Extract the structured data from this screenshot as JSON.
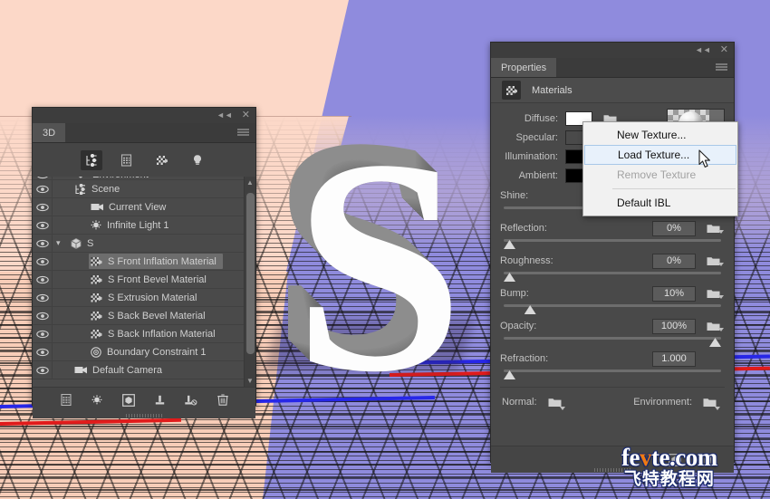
{
  "canvas": {
    "letter": "S",
    "background_color": "#fcd8c8",
    "plane_color": "#8f8bdd",
    "grid_color": "#141414",
    "axis_blue": "#2727e8",
    "axis_red": "#e01b1b"
  },
  "panel3d": {
    "tab_label": "3D",
    "collapse_icon": "double-chevron-left-icon",
    "close_icon": "close-icon",
    "menu_icon": "hamburger-menu-icon",
    "filters": [
      {
        "name": "scene-filter",
        "icon": "scene-tree-icon",
        "active": true
      },
      {
        "name": "mesh-filter",
        "icon": "mesh-grid-icon",
        "active": false
      },
      {
        "name": "materials-filter",
        "icon": "materials-icon",
        "active": false
      },
      {
        "name": "lights-filter",
        "icon": "light-bulb-icon",
        "active": false
      }
    ],
    "items": [
      {
        "label": "Environment",
        "icon": "environment-icon",
        "indent": 1,
        "selected": false,
        "twisty": "",
        "clipped": true
      },
      {
        "label": "Scene",
        "icon": "scene-tree-icon",
        "indent": 1,
        "selected": false,
        "twisty": ""
      },
      {
        "label": "Current View",
        "icon": "camera-icon",
        "indent": 2,
        "selected": false,
        "twisty": ""
      },
      {
        "label": "Infinite Light 1",
        "icon": "light-bulb-icon",
        "indent": 2,
        "selected": false,
        "twisty": ""
      },
      {
        "label": "S",
        "icon": "mesh-3d-icon",
        "indent": 1,
        "selected": false,
        "twisty": "v"
      },
      {
        "label": "S Front Inflation Material",
        "icon": "materials-icon",
        "indent": 2,
        "selected": true,
        "twisty": ""
      },
      {
        "label": "S Front Bevel Material",
        "icon": "materials-icon",
        "indent": 2,
        "selected": false,
        "twisty": ""
      },
      {
        "label": "S Extrusion Material",
        "icon": "materials-icon",
        "indent": 2,
        "selected": false,
        "twisty": ""
      },
      {
        "label": "S Back Bevel Material",
        "icon": "materials-icon",
        "indent": 2,
        "selected": false,
        "twisty": ""
      },
      {
        "label": "S Back Inflation Material",
        "icon": "materials-icon",
        "indent": 2,
        "selected": false,
        "twisty": ""
      },
      {
        "label": "Boundary Constraint 1",
        "icon": "boundary-constraint-icon",
        "indent": 2,
        "selected": false,
        "twisty": ""
      },
      {
        "label": "Default Camera",
        "icon": "camera-icon",
        "indent": 1,
        "selected": false,
        "twisty": ""
      }
    ],
    "bottom_tools": [
      {
        "name": "add-mesh-button",
        "icon": "mesh-grid-icon"
      },
      {
        "name": "add-light-button",
        "icon": "light-bulb-icon"
      },
      {
        "name": "render-button",
        "icon": "render-cube-icon"
      },
      {
        "name": "add-constraint-button",
        "icon": "constraint-icon"
      },
      {
        "name": "remove-constraint-button",
        "icon": "constraint-remove-icon"
      },
      {
        "name": "delete-button",
        "icon": "trash-icon"
      }
    ],
    "scroll_up_icon": "chevron-up-icon",
    "scroll_down_icon": "chevron-down-icon"
  },
  "properties": {
    "tab_label": "Properties",
    "collapse_icon": "double-chevron-left-icon",
    "close_icon": "close-icon",
    "menu_icon": "hamburger-menu-icon",
    "section_title": "Materials",
    "section_icon": "materials-icon",
    "colors": [
      {
        "label": "Diffuse:",
        "value": "#ffffff",
        "name": "diffuse"
      },
      {
        "label": "Specular:",
        "value": "#4a4a4a",
        "name": "specular"
      },
      {
        "label": "Illumination:",
        "value": "#000000",
        "name": "illumination"
      },
      {
        "label": "Ambient:",
        "value": "#000000",
        "name": "ambient"
      }
    ],
    "sliders": [
      {
        "label": "Shine:",
        "value": "",
        "percent": 0,
        "name": "shine",
        "has_field": false,
        "has_folder": false
      },
      {
        "label": "Reflection:",
        "value": "0%",
        "percent": 0,
        "name": "reflection",
        "has_field": true,
        "has_folder": true
      },
      {
        "label": "Roughness:",
        "value": "0%",
        "percent": 0,
        "name": "roughness",
        "has_field": true,
        "has_folder": true
      },
      {
        "label": "Bump:",
        "value": "10%",
        "percent": 10,
        "name": "bump",
        "has_field": true,
        "has_folder": true
      },
      {
        "label": "Opacity:",
        "value": "100%",
        "percent": 100,
        "name": "opacity",
        "has_field": true,
        "has_folder": true
      },
      {
        "label": "Refraction:",
        "value": "1.000",
        "percent": 0,
        "name": "refraction",
        "has_field": true,
        "has_folder": false
      }
    ],
    "shine_knob_percent": 74,
    "maps": [
      {
        "label": "Normal:",
        "name": "normal-map"
      },
      {
        "label": "Environment:",
        "name": "environment-map"
      }
    ],
    "footer_tools": [
      {
        "name": "new-material-button",
        "icon": "render-cube-icon"
      },
      {
        "name": "delete-material-button",
        "icon": "trash-icon"
      }
    ]
  },
  "context_menu": {
    "items": [
      {
        "label": "New Texture...",
        "state": "normal",
        "name": "new-texture"
      },
      {
        "label": "Load Texture...",
        "state": "highlighted",
        "name": "load-texture"
      },
      {
        "label": "Remove Texture",
        "state": "disabled",
        "name": "remove-texture"
      },
      {
        "label": "Default IBL",
        "state": "normal",
        "name": "default-ibl",
        "separator_before": true
      }
    ]
  },
  "watermark": {
    "line1_pre": "fe",
    "line1_accent": "v",
    "line1_post": "te.com",
    "line2": "飞特教程网"
  }
}
